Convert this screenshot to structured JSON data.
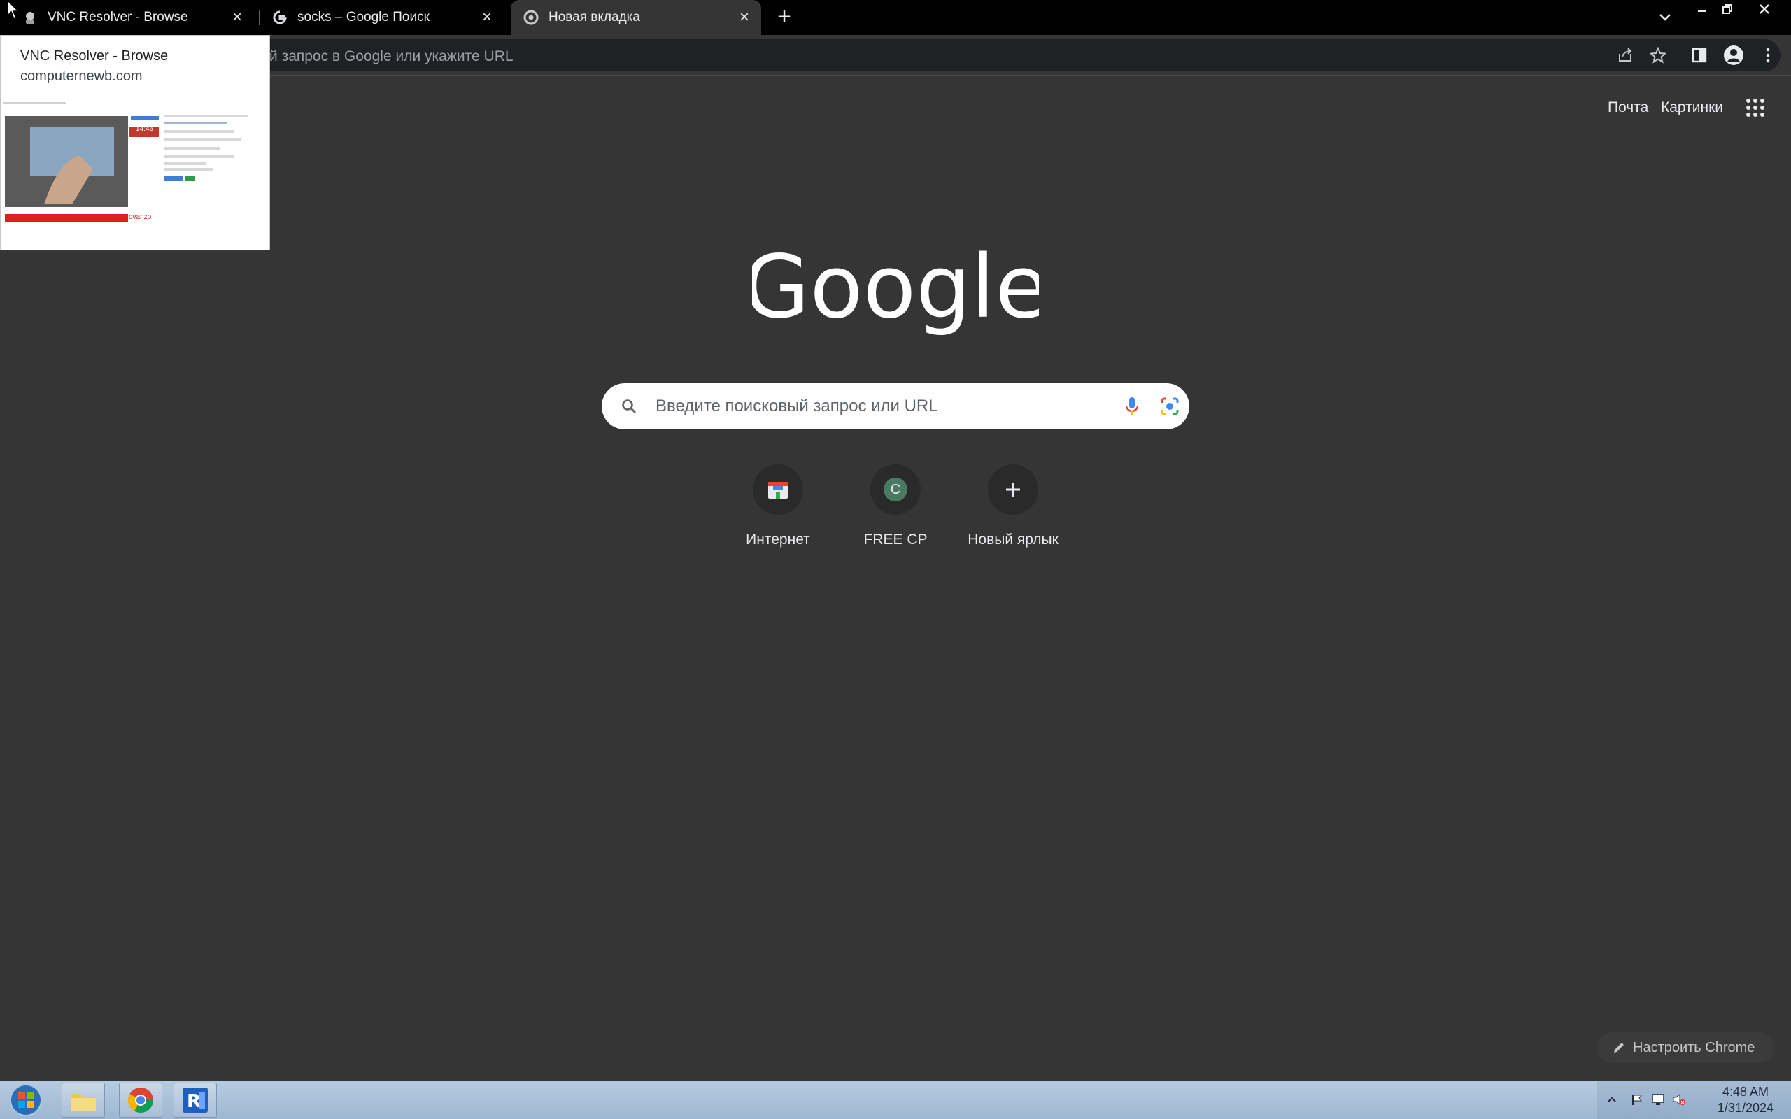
{
  "tabs": [
    {
      "title": "VNC Resolver - Browse",
      "favicon": "vnc-resolver-icon"
    },
    {
      "title": "socks – Google Поиск",
      "favicon": "google-g-icon"
    },
    {
      "title": "Новая вкладка",
      "favicon": "chrome-icon",
      "active": true
    }
  ],
  "hover_card": {
    "title": "VNC Resolver - Browse",
    "domain": "computernewb.com",
    "thumb_time": "14:46",
    "thumb_brand": "ovanzo"
  },
  "omnibox": {
    "placeholder": "й запрос в Google или укажите URL"
  },
  "ntp": {
    "links": {
      "mail": "Почта",
      "images": "Картинки"
    },
    "logo": "Google",
    "search_placeholder": "Введите поисковый запрос или URL",
    "shortcuts": [
      {
        "label": "Интернет",
        "icon": "store-icon"
      },
      {
        "label": "FREE CP",
        "icon": "letter-c-icon",
        "letter": "C"
      },
      {
        "label": "Новый ярлык",
        "icon": "plus-icon"
      }
    ],
    "customize_label": "Настроить Chrome"
  },
  "taskbar": {
    "items": [
      "start-button",
      "explorer-icon",
      "chrome-icon",
      "vnc-icon"
    ],
    "clock": {
      "time": "4:48 AM",
      "date": "1/31/2024"
    }
  },
  "colors": {
    "background": "#353535",
    "tabstrip": "#000000",
    "omnibox": "#202124",
    "taskbar": "#b7cbe0",
    "text": "#e8eaed"
  }
}
